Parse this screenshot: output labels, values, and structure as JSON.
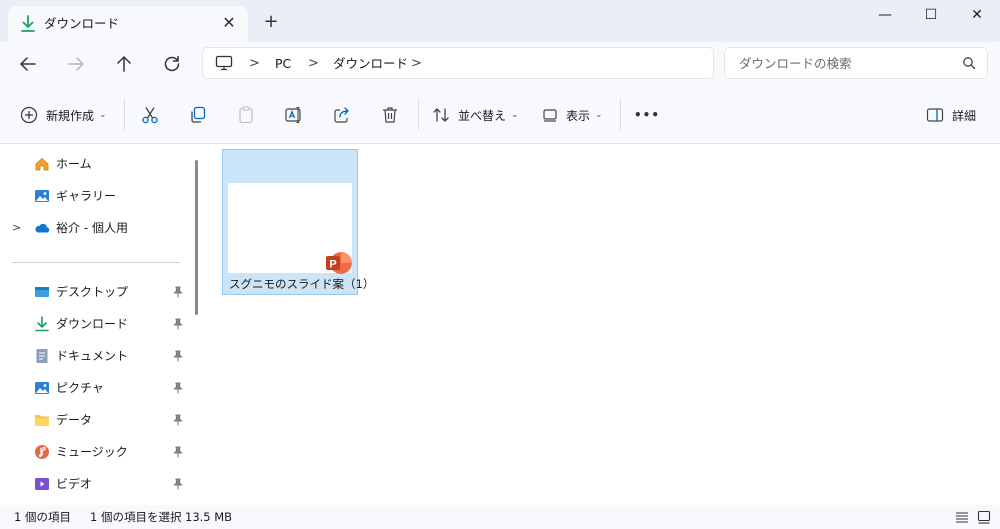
{
  "window": {
    "tab_title": "ダウンロード",
    "close_tab": "✕",
    "new_tab": "+",
    "minimize": "—",
    "maximize": "☐",
    "close": "✕"
  },
  "address": {
    "crumbs": [
      "PC",
      "ダウンロード"
    ],
    "separator": ">",
    "search_placeholder": "ダウンロードの検索"
  },
  "toolbar": {
    "new_label": "新規作成",
    "sort_label": "並べ替え",
    "view_label": "表示",
    "more_label": "•••",
    "details_label": "詳細"
  },
  "sidebar": {
    "items": [
      {
        "label": "ホーム",
        "icon": "home-icon"
      },
      {
        "label": "ギャラリー",
        "icon": "gallery-icon"
      },
      {
        "label": "裕介 - 個人用",
        "icon": "onedrive-icon"
      },
      {
        "label": "デスクトップ",
        "icon": "desktop-icon"
      },
      {
        "label": "ダウンロード",
        "icon": "download-icon"
      },
      {
        "label": "ドキュメント",
        "icon": "document-icon"
      },
      {
        "label": "ピクチャ",
        "icon": "pictures-icon"
      },
      {
        "label": "データ",
        "icon": "folder-icon"
      },
      {
        "label": "ミュージック",
        "icon": "music-icon"
      },
      {
        "label": "ビデオ",
        "icon": "video-icon"
      }
    ]
  },
  "files": [
    {
      "name": "スグニモのスライド案（1）",
      "type": "powerpoint",
      "selected": true
    }
  ],
  "status": {
    "item_count": "1 個の項目",
    "selection": "1 個の項目を選択",
    "size": "13.5 MB"
  },
  "colors": {
    "accent": "#0067c0",
    "selection_bg": "#cce4f7",
    "powerpoint": "#d24726",
    "download_green": "#1aa260"
  }
}
